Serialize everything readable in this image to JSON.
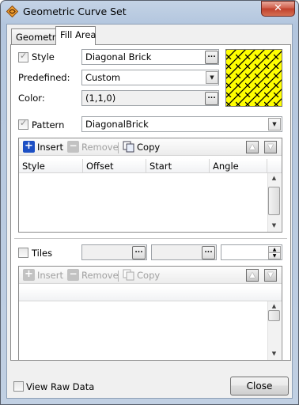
{
  "window": {
    "title": "Geometric Curve Set",
    "close_glyph": "✕"
  },
  "tabs": [
    {
      "label": "Geometry",
      "active": false
    },
    {
      "label": "Fill Area",
      "active": true
    }
  ],
  "fill_area": {
    "style": {
      "label": "Style",
      "checked": true,
      "value": "Diagonal Brick",
      "button": "..."
    },
    "predefined": {
      "label": "Predefined:",
      "value": "Custom"
    },
    "color": {
      "label": "Color:",
      "value": "(1,1,0)",
      "button": "...",
      "swatch_color": "#ffff00",
      "pattern_color": "#000000"
    },
    "pattern": {
      "label": "Pattern",
      "checked": true,
      "value": "DiagonalBrick"
    }
  },
  "pattern_list": {
    "toolbar": {
      "insert": "Insert",
      "remove": "Remove",
      "copy": "Copy"
    },
    "columns": [
      "Style",
      "Offset",
      "Start",
      "Angle"
    ]
  },
  "tiles": {
    "label": "Tiles",
    "checked": false,
    "field1_button": "...",
    "field2_button": "...",
    "toolbar": {
      "insert": "Insert",
      "remove": "Remove",
      "copy": "Copy"
    }
  },
  "footer": {
    "view_raw_label": "View Raw Data",
    "close_label": "Close"
  },
  "colors": {
    "insert_icon": "#1c4fc4",
    "disabled_text": "#a0a0a0"
  }
}
